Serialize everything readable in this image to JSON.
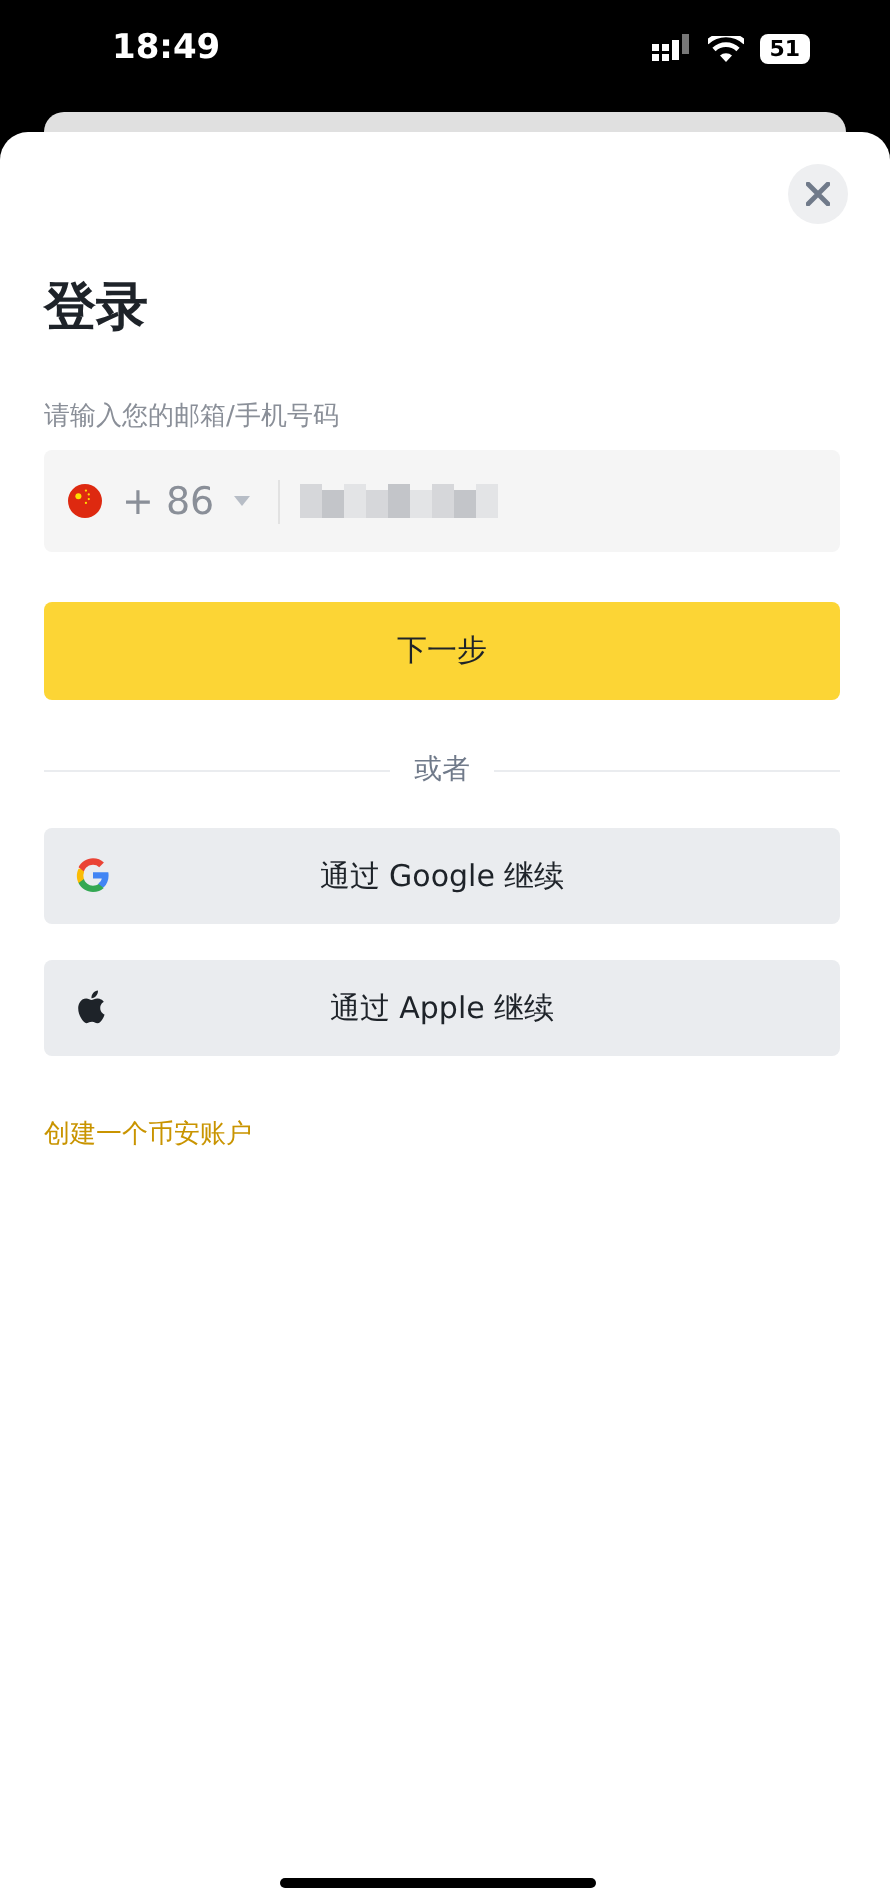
{
  "status_bar": {
    "time": "18:49",
    "battery": "51"
  },
  "title": "登录",
  "field_label": "请输入您的邮箱/手机号码",
  "phone_field": {
    "country_code": "+ 86"
  },
  "next_button": "下一步",
  "divider_text": "或者",
  "social_buttons": [
    {
      "kind": "google",
      "label": "通过 Google 继续"
    },
    {
      "kind": "apple",
      "label": "通过 Apple 继续"
    }
  ],
  "create_account_link": "创建一个币安账户"
}
